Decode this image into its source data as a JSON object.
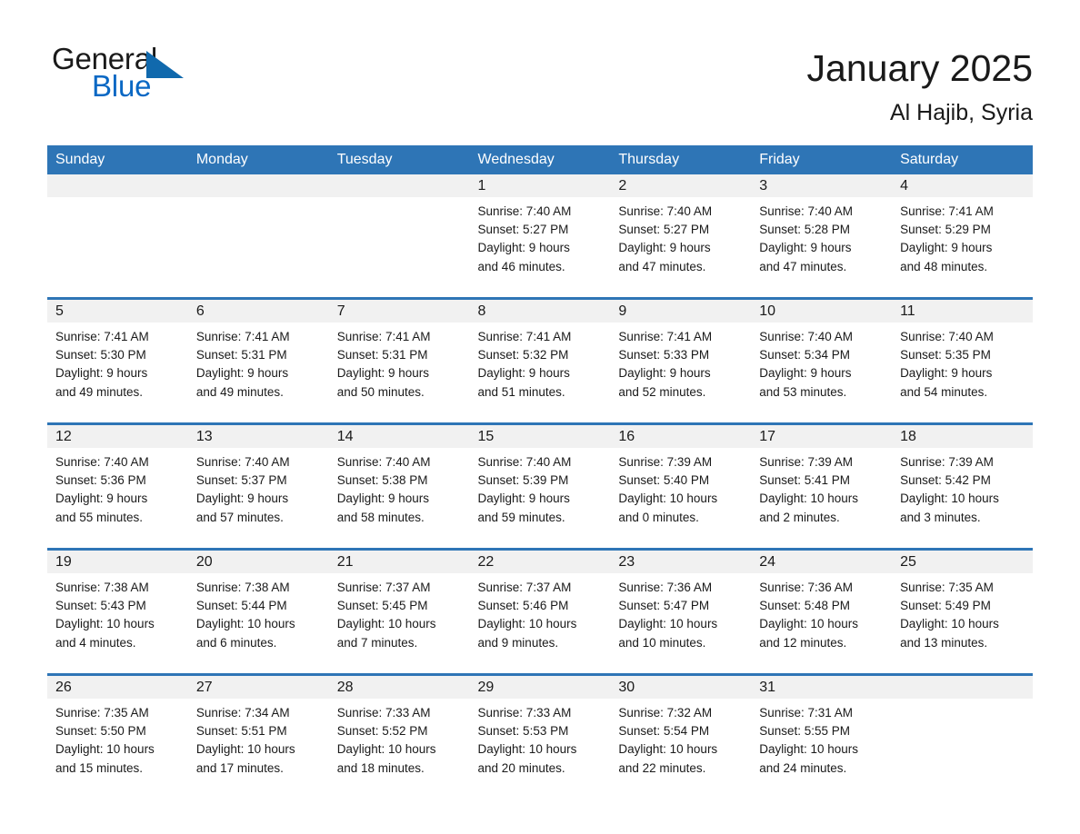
{
  "brand": {
    "name_part1": "General",
    "name_part2": "Blue",
    "triangle_color": "#1069ad",
    "blue_color": "#0a68c4"
  },
  "header": {
    "title": "January 2025",
    "location": "Al Hajib, Syria",
    "accent_color": "#2e75b6",
    "daynum_band_color": "#f1f1f1"
  },
  "weekday_headers": [
    "Sunday",
    "Monday",
    "Tuesday",
    "Wednesday",
    "Thursday",
    "Friday",
    "Saturday"
  ],
  "weeks": [
    {
      "days": [
        {
          "num": "",
          "line1": "",
          "line2": "",
          "line3": "",
          "line4": ""
        },
        {
          "num": "",
          "line1": "",
          "line2": "",
          "line3": "",
          "line4": ""
        },
        {
          "num": "",
          "line1": "",
          "line2": "",
          "line3": "",
          "line4": ""
        },
        {
          "num": "1",
          "line1": "Sunrise: 7:40 AM",
          "line2": "Sunset: 5:27 PM",
          "line3": "Daylight: 9 hours",
          "line4": "and 46 minutes."
        },
        {
          "num": "2",
          "line1": "Sunrise: 7:40 AM",
          "line2": "Sunset: 5:27 PM",
          "line3": "Daylight: 9 hours",
          "line4": "and 47 minutes."
        },
        {
          "num": "3",
          "line1": "Sunrise: 7:40 AM",
          "line2": "Sunset: 5:28 PM",
          "line3": "Daylight: 9 hours",
          "line4": "and 47 minutes."
        },
        {
          "num": "4",
          "line1": "Sunrise: 7:41 AM",
          "line2": "Sunset: 5:29 PM",
          "line3": "Daylight: 9 hours",
          "line4": "and 48 minutes."
        }
      ]
    },
    {
      "days": [
        {
          "num": "5",
          "line1": "Sunrise: 7:41 AM",
          "line2": "Sunset: 5:30 PM",
          "line3": "Daylight: 9 hours",
          "line4": "and 49 minutes."
        },
        {
          "num": "6",
          "line1": "Sunrise: 7:41 AM",
          "line2": "Sunset: 5:31 PM",
          "line3": "Daylight: 9 hours",
          "line4": "and 49 minutes."
        },
        {
          "num": "7",
          "line1": "Sunrise: 7:41 AM",
          "line2": "Sunset: 5:31 PM",
          "line3": "Daylight: 9 hours",
          "line4": "and 50 minutes."
        },
        {
          "num": "8",
          "line1": "Sunrise: 7:41 AM",
          "line2": "Sunset: 5:32 PM",
          "line3": "Daylight: 9 hours",
          "line4": "and 51 minutes."
        },
        {
          "num": "9",
          "line1": "Sunrise: 7:41 AM",
          "line2": "Sunset: 5:33 PM",
          "line3": "Daylight: 9 hours",
          "line4": "and 52 minutes."
        },
        {
          "num": "10",
          "line1": "Sunrise: 7:40 AM",
          "line2": "Sunset: 5:34 PM",
          "line3": "Daylight: 9 hours",
          "line4": "and 53 minutes."
        },
        {
          "num": "11",
          "line1": "Sunrise: 7:40 AM",
          "line2": "Sunset: 5:35 PM",
          "line3": "Daylight: 9 hours",
          "line4": "and 54 minutes."
        }
      ]
    },
    {
      "days": [
        {
          "num": "12",
          "line1": "Sunrise: 7:40 AM",
          "line2": "Sunset: 5:36 PM",
          "line3": "Daylight: 9 hours",
          "line4": "and 55 minutes."
        },
        {
          "num": "13",
          "line1": "Sunrise: 7:40 AM",
          "line2": "Sunset: 5:37 PM",
          "line3": "Daylight: 9 hours",
          "line4": "and 57 minutes."
        },
        {
          "num": "14",
          "line1": "Sunrise: 7:40 AM",
          "line2": "Sunset: 5:38 PM",
          "line3": "Daylight: 9 hours",
          "line4": "and 58 minutes."
        },
        {
          "num": "15",
          "line1": "Sunrise: 7:40 AM",
          "line2": "Sunset: 5:39 PM",
          "line3": "Daylight: 9 hours",
          "line4": "and 59 minutes."
        },
        {
          "num": "16",
          "line1": "Sunrise: 7:39 AM",
          "line2": "Sunset: 5:40 PM",
          "line3": "Daylight: 10 hours",
          "line4": "and 0 minutes."
        },
        {
          "num": "17",
          "line1": "Sunrise: 7:39 AM",
          "line2": "Sunset: 5:41 PM",
          "line3": "Daylight: 10 hours",
          "line4": "and 2 minutes."
        },
        {
          "num": "18",
          "line1": "Sunrise: 7:39 AM",
          "line2": "Sunset: 5:42 PM",
          "line3": "Daylight: 10 hours",
          "line4": "and 3 minutes."
        }
      ]
    },
    {
      "days": [
        {
          "num": "19",
          "line1": "Sunrise: 7:38 AM",
          "line2": "Sunset: 5:43 PM",
          "line3": "Daylight: 10 hours",
          "line4": "and 4 minutes."
        },
        {
          "num": "20",
          "line1": "Sunrise: 7:38 AM",
          "line2": "Sunset: 5:44 PM",
          "line3": "Daylight: 10 hours",
          "line4": "and 6 minutes."
        },
        {
          "num": "21",
          "line1": "Sunrise: 7:37 AM",
          "line2": "Sunset: 5:45 PM",
          "line3": "Daylight: 10 hours",
          "line4": "and 7 minutes."
        },
        {
          "num": "22",
          "line1": "Sunrise: 7:37 AM",
          "line2": "Sunset: 5:46 PM",
          "line3": "Daylight: 10 hours",
          "line4": "and 9 minutes."
        },
        {
          "num": "23",
          "line1": "Sunrise: 7:36 AM",
          "line2": "Sunset: 5:47 PM",
          "line3": "Daylight: 10 hours",
          "line4": "and 10 minutes."
        },
        {
          "num": "24",
          "line1": "Sunrise: 7:36 AM",
          "line2": "Sunset: 5:48 PM",
          "line3": "Daylight: 10 hours",
          "line4": "and 12 minutes."
        },
        {
          "num": "25",
          "line1": "Sunrise: 7:35 AM",
          "line2": "Sunset: 5:49 PM",
          "line3": "Daylight: 10 hours",
          "line4": "and 13 minutes."
        }
      ]
    },
    {
      "days": [
        {
          "num": "26",
          "line1": "Sunrise: 7:35 AM",
          "line2": "Sunset: 5:50 PM",
          "line3": "Daylight: 10 hours",
          "line4": "and 15 minutes."
        },
        {
          "num": "27",
          "line1": "Sunrise: 7:34 AM",
          "line2": "Sunset: 5:51 PM",
          "line3": "Daylight: 10 hours",
          "line4": "and 17 minutes."
        },
        {
          "num": "28",
          "line1": "Sunrise: 7:33 AM",
          "line2": "Sunset: 5:52 PM",
          "line3": "Daylight: 10 hours",
          "line4": "and 18 minutes."
        },
        {
          "num": "29",
          "line1": "Sunrise: 7:33 AM",
          "line2": "Sunset: 5:53 PM",
          "line3": "Daylight: 10 hours",
          "line4": "and 20 minutes."
        },
        {
          "num": "30",
          "line1": "Sunrise: 7:32 AM",
          "line2": "Sunset: 5:54 PM",
          "line3": "Daylight: 10 hours",
          "line4": "and 22 minutes."
        },
        {
          "num": "31",
          "line1": "Sunrise: 7:31 AM",
          "line2": "Sunset: 5:55 PM",
          "line3": "Daylight: 10 hours",
          "line4": "and 24 minutes."
        },
        {
          "num": "",
          "line1": "",
          "line2": "",
          "line3": "",
          "line4": ""
        }
      ]
    }
  ]
}
